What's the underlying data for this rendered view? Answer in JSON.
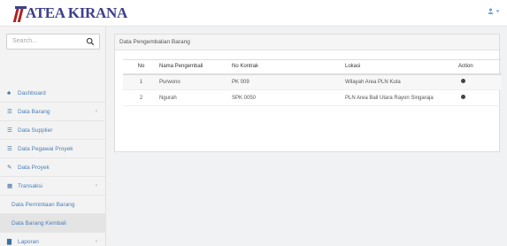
{
  "brand": {
    "name": "ATEA KIRANA",
    "logo_color": "#b31d1d",
    "text_color": "#3d3f8c"
  },
  "header": {
    "user_icon": "user-icon",
    "dropdown_icon": "caret-down-icon"
  },
  "sidebar": {
    "search_placeholder": "Search...",
    "items": [
      {
        "label": "Dashboard",
        "icon": "dashboard-icon",
        "glyph": "♣"
      },
      {
        "label": "Data Barang",
        "icon": "list-icon",
        "glyph": "☰",
        "chevron": "‹"
      },
      {
        "label": "Data Supplier",
        "icon": "list-icon",
        "glyph": "☰"
      },
      {
        "label": "Data Pegawai Proyek",
        "icon": "list-icon",
        "glyph": "☰"
      },
      {
        "label": "Data Proyek",
        "icon": "edit-icon",
        "glyph": "✎"
      },
      {
        "label": "Transaksi",
        "icon": "table-icon",
        "glyph": "▦",
        "chevron": "‹"
      },
      {
        "label": "Data Permintaan Barang",
        "sub": true
      },
      {
        "label": "Data Barang Kembali",
        "sub": true,
        "active": true
      },
      {
        "label": "Laporan",
        "icon": "chart-icon",
        "glyph": "▇",
        "chevron": "‹"
      }
    ]
  },
  "panel": {
    "title": "Data Pengembalian Barang",
    "columns": [
      "No",
      "Nama Pengembali",
      "No Kontrak",
      "Lokasi",
      "Action"
    ],
    "rows": [
      {
        "no": "1",
        "nama": "Purwono",
        "kontrak": "PK 009",
        "lokasi": "Wilayah Area PLN Kuta"
      },
      {
        "no": "2",
        "nama": "Ngurah",
        "kontrak": "SPK 0050",
        "lokasi": "PLN Area Bali Utara Rayon Singaraja"
      }
    ]
  }
}
